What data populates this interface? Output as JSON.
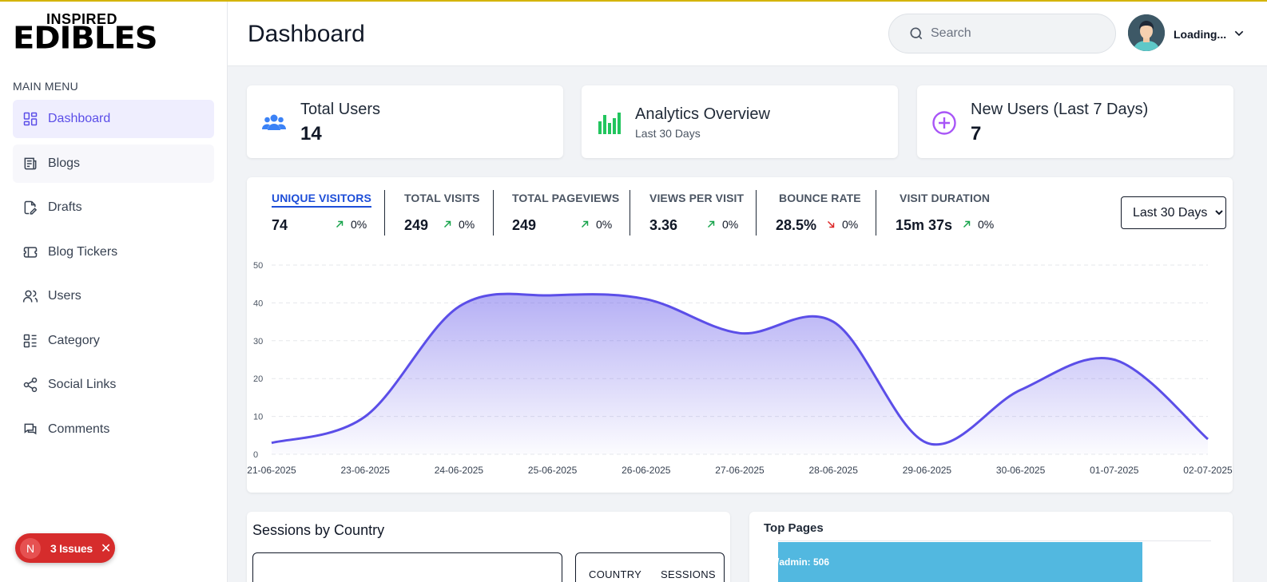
{
  "brand": {
    "top": "INSPIRED",
    "bottom": "EDIBLES"
  },
  "sidebar": {
    "heading": "MAIN MENU",
    "items": [
      {
        "label": "Dashboard",
        "icon": "grid-icon",
        "active": true
      },
      {
        "label": "Blogs",
        "icon": "newspaper-icon"
      },
      {
        "label": "Drafts",
        "icon": "file-edit-icon"
      },
      {
        "label": "Blog Tickers",
        "icon": "ticket-icon"
      },
      {
        "label": "Users",
        "icon": "users-icon"
      },
      {
        "label": "Category",
        "icon": "list-icon"
      },
      {
        "label": "Social Links",
        "icon": "share-icon"
      },
      {
        "label": "Comments",
        "icon": "comments-icon"
      }
    ]
  },
  "issues": {
    "avatar": "N",
    "label": "3 Issues"
  },
  "header": {
    "title": "Dashboard",
    "search_placeholder": "Search",
    "user_name": "Loading..."
  },
  "stats": [
    {
      "title": "Total Users",
      "value": "14",
      "icon": "users-icon",
      "color": "#3b82f6"
    },
    {
      "title": "Analytics Overview",
      "sub": "Last 30 Days",
      "icon": "bar-chart-icon",
      "color": "#22c55e"
    },
    {
      "title": "New Users (Last 7 Days)",
      "value": "7",
      "icon": "plus-circle-icon",
      "color": "#a855f7"
    }
  ],
  "metrics": [
    {
      "label": "UNIQUE VISITORS",
      "value": "74",
      "change": "0%",
      "direction": "up",
      "active": true
    },
    {
      "label": "TOTAL VISITS",
      "value": "249",
      "change": "0%",
      "direction": "up"
    },
    {
      "label": "TOTAL PAGEVIEWS",
      "value": "249",
      "change": "0%",
      "direction": "up"
    },
    {
      "label": "VIEWS PER VISIT",
      "value": "3.36",
      "change": "0%",
      "direction": "up"
    },
    {
      "label": "BOUNCE RATE",
      "value": "28.5%",
      "change": "0%",
      "direction": "down"
    },
    {
      "label": "VISIT DURATION",
      "value": "15m 37s",
      "change": "0%",
      "direction": "up"
    }
  ],
  "range": {
    "selected": "Last 30 Days"
  },
  "chart_data": {
    "type": "area",
    "x": [
      "21-06-2025",
      "23-06-2025",
      "24-06-2025",
      "25-06-2025",
      "26-06-2025",
      "27-06-2025",
      "28-06-2025",
      "29-06-2025",
      "30-06-2025",
      "01-07-2025",
      "02-07-2025"
    ],
    "values": [
      3,
      10,
      39,
      42,
      41,
      32,
      35,
      3,
      17,
      25,
      4
    ],
    "ylim": [
      0,
      50
    ],
    "yticks": [
      0,
      10,
      20,
      30,
      40,
      50
    ],
    "grid": true,
    "color": "#5b4ee8"
  },
  "sessions": {
    "title": "Sessions by Country",
    "col_country": "COUNTRY",
    "col_sessions": "SESSIONS"
  },
  "top_pages": {
    "title": "Top Pages",
    "bar_label": "/admin: 506",
    "bar_value": 506,
    "color": "#52b8e0"
  }
}
